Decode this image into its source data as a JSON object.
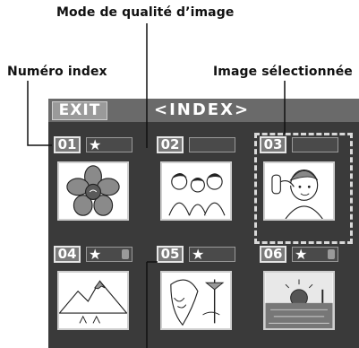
{
  "callouts": {
    "image_quality_mode": "Mode de qualité d’image",
    "index_number": "Numéro index",
    "selected_image": "Image sélectionnée"
  },
  "screen": {
    "exit_label": "EXIT",
    "title": "<INDEX>"
  },
  "cells": [
    {
      "number": "01",
      "star": "★",
      "locked": false,
      "thumbnail_icon": "flower-icon"
    },
    {
      "number": "02",
      "star": "",
      "locked": false,
      "thumbnail_icon": "people-icon"
    },
    {
      "number": "03",
      "star": "",
      "locked": false,
      "thumbnail_icon": "girl-phone-icon",
      "selected": true
    },
    {
      "number": "04",
      "star": "★",
      "locked": true,
      "thumbnail_icon": "mountain-icon"
    },
    {
      "number": "05",
      "star": "★",
      "locked": false,
      "thumbnail_icon": "woman-wind-icon"
    },
    {
      "number": "06",
      "star": "★",
      "locked": true,
      "thumbnail_icon": "sunset-sea-icon"
    }
  ],
  "colors": {
    "screen_bg": "#3a3a3a",
    "topbar_bg": "#6a6a6a",
    "text_on_screen": "#ffffff"
  }
}
